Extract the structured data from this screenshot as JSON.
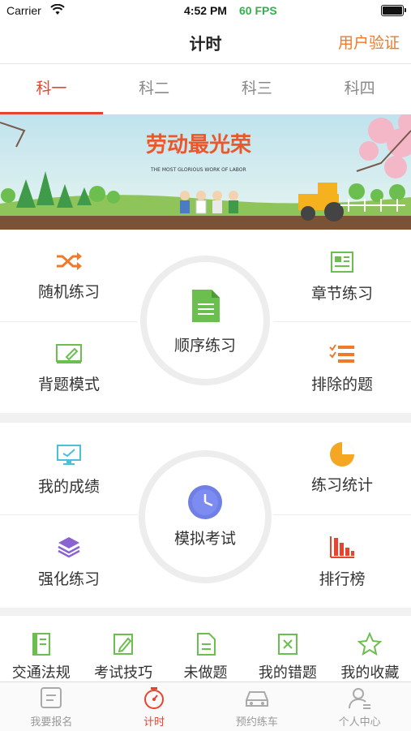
{
  "status_bar": {
    "carrier": "Carrier",
    "time": "4:52 PM",
    "fps": "60 FPS"
  },
  "nav": {
    "title": "计时",
    "right_action": "用户验证"
  },
  "subject_tabs": [
    {
      "label": "科一",
      "active": true
    },
    {
      "label": "科二",
      "active": false
    },
    {
      "label": "科三",
      "active": false
    },
    {
      "label": "科四",
      "active": false
    }
  ],
  "banner": {
    "headline": "劳动最光荣",
    "subline": "THE MOST GLORIOUS WORK OF LABOR"
  },
  "practice_section": {
    "top_left": {
      "label": "随机练习",
      "icon": "shuffle-icon"
    },
    "top_right": {
      "label": "章节练习",
      "icon": "chapter-icon"
    },
    "center": {
      "label": "顺序练习",
      "icon": "document-icon"
    },
    "bottom_left": {
      "label": "背题模式",
      "icon": "edit-icon"
    },
    "bottom_right": {
      "label": "排除的题",
      "icon": "list-icon"
    }
  },
  "exam_section": {
    "top_left": {
      "label": "我的成绩",
      "icon": "monitor-icon"
    },
    "top_right": {
      "label": "练习统计",
      "icon": "pie-icon"
    },
    "center": {
      "label": "模拟考试",
      "icon": "clock-icon"
    },
    "bottom_left": {
      "label": "强化练习",
      "icon": "layers-icon"
    },
    "bottom_right": {
      "label": "排行榜",
      "icon": "bar-chart-icon"
    }
  },
  "quick_row": [
    {
      "label": "交通法规",
      "icon": "book-icon"
    },
    {
      "label": "考试技巧",
      "icon": "pencil-icon"
    },
    {
      "label": "未做题",
      "icon": "file-icon"
    },
    {
      "label": "我的错题",
      "icon": "wrong-icon"
    },
    {
      "label": "我的收藏",
      "icon": "star-icon"
    }
  ],
  "tab_bar": [
    {
      "label": "我要报名",
      "icon": "signup-icon",
      "active": false
    },
    {
      "label": "计时",
      "icon": "timer-icon",
      "active": true
    },
    {
      "label": "预约练车",
      "icon": "car-icon",
      "active": false
    },
    {
      "label": "个人中心",
      "icon": "user-icon",
      "active": false
    }
  ],
  "colors": {
    "accent": "#e8432e",
    "orange": "#f07a2a",
    "green": "#6bbf4e",
    "fps_green": "#2fb34a"
  }
}
